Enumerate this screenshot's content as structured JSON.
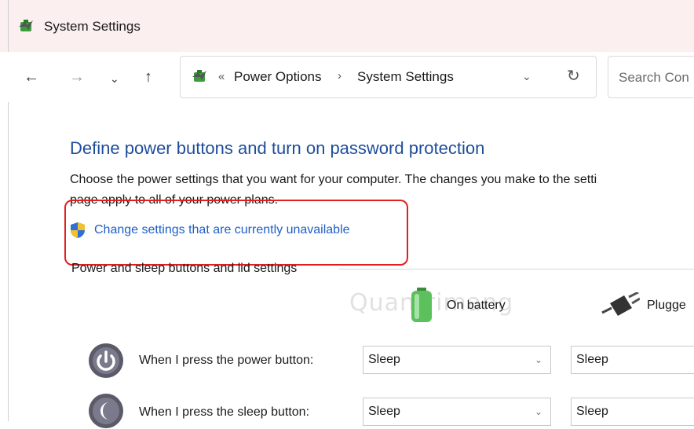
{
  "window": {
    "title": "System Settings"
  },
  "nav": {
    "back": "←",
    "forward": "→",
    "recent": "⌄",
    "up": "↑"
  },
  "address": {
    "overflow": "«",
    "crumbs": [
      "Power Options",
      "System Settings"
    ],
    "separator": "›",
    "dropdown": "⌄",
    "refresh": "↻"
  },
  "search": {
    "placeholder": "Search Con"
  },
  "main": {
    "heading": "Define power buttons and turn on password protection",
    "description_line1": "Choose the power settings that you want for your computer. The changes you make to the setti",
    "description_line2": "page apply to all of your power plans.",
    "change_link": "Change settings that are currently unavailable",
    "section_label": "Power and sleep buttons and lid settings",
    "columns": {
      "battery": "On battery",
      "plugged": "Plugge"
    },
    "rows": [
      {
        "label": "When I press the power button:",
        "battery": "Sleep",
        "plugged": "Sleep"
      },
      {
        "label": "When I press the sleep button:",
        "battery": "Sleep",
        "plugged": "Sleep"
      }
    ]
  },
  "watermark": "Quantrimang",
  "colors": {
    "heading": "#1e4d9b",
    "link": "#1e5fc8",
    "highlight": "#e0201e",
    "titlebar": "#fbeff0"
  }
}
